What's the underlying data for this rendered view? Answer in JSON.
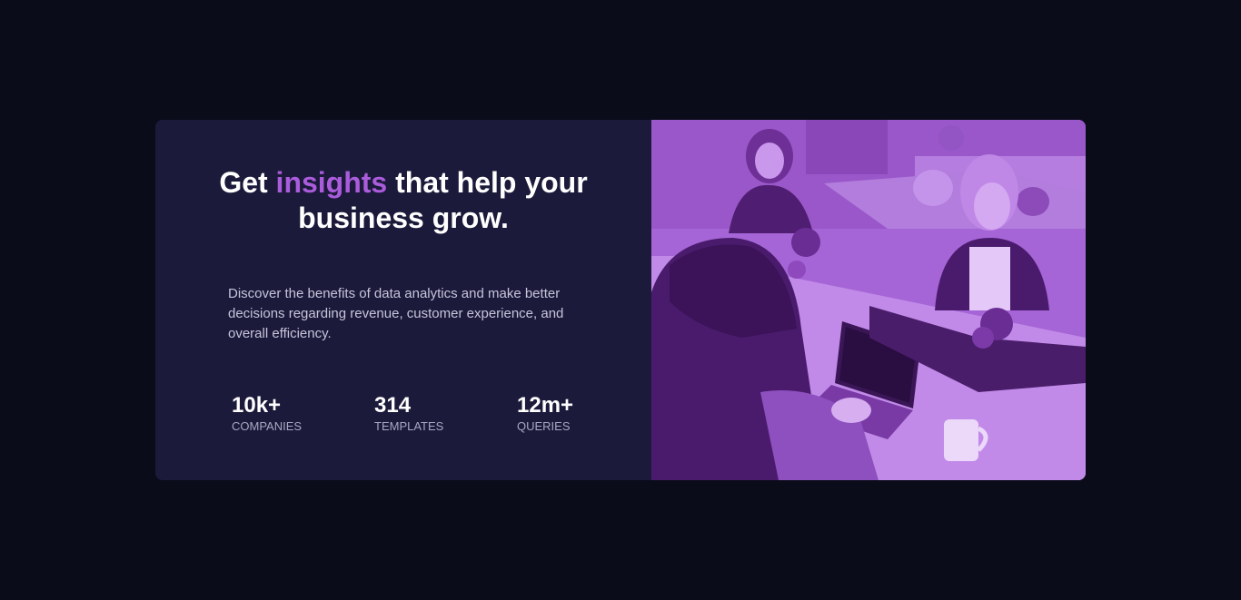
{
  "hero": {
    "title_part1": "Get ",
    "title_accent": "insights",
    "title_part2": " that help your business grow.",
    "description": "Discover the benefits of data analytics and make better decisions regarding revenue, customer experience, and overall efficiency.",
    "stats": [
      {
        "value": "10k+",
        "label": "COMPANIES"
      },
      {
        "value": "314",
        "label": "TEMPLATES"
      },
      {
        "value": "12m+",
        "label": "QUERIES"
      }
    ]
  },
  "image": {
    "subject": "people-working-photo"
  },
  "colors": {
    "page_background": "#0a0c1a",
    "card_background": "#1b1a3b",
    "accent": "#aa5cdb",
    "image_overlay": "#a162d2"
  }
}
